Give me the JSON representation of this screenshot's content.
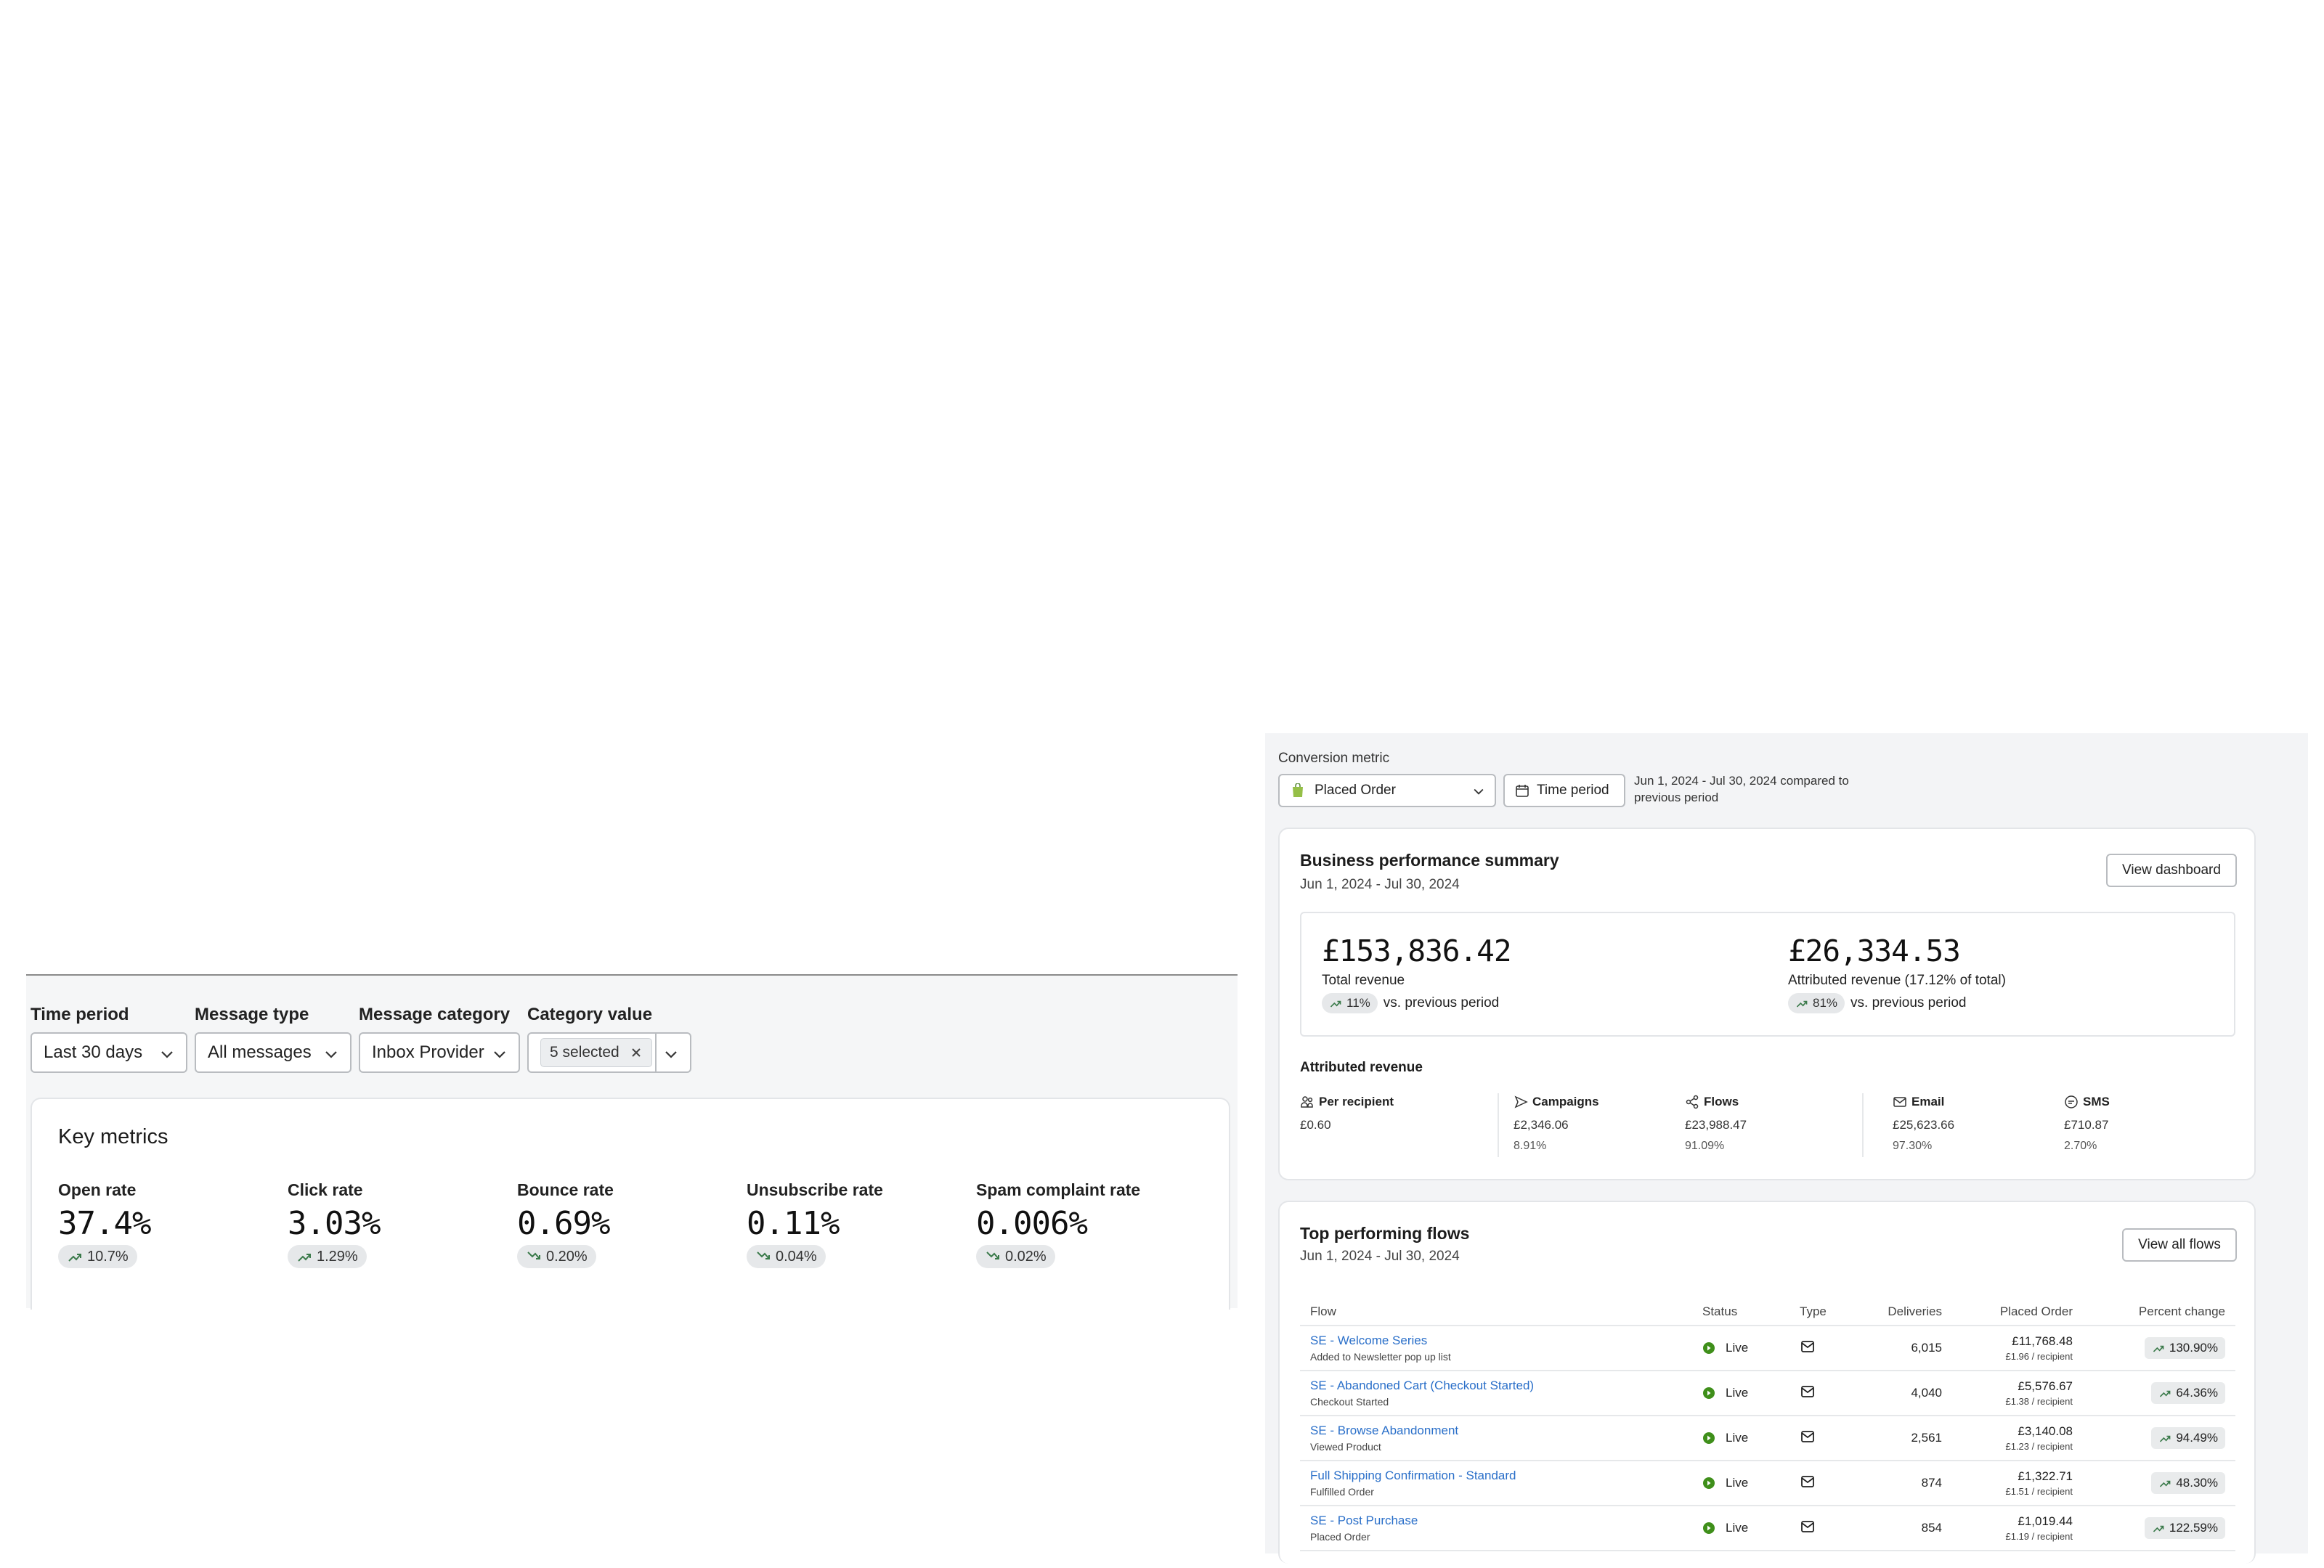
{
  "filters": {
    "time_period": {
      "label": "Time period",
      "value": "Last 30 days"
    },
    "message_type": {
      "label": "Message type",
      "value": "All messages"
    },
    "message_category": {
      "label": "Message category",
      "value": "Inbox Provider"
    },
    "category_value": {
      "label": "Category value",
      "chip": "5 selected"
    }
  },
  "key_metrics": {
    "title": "Key metrics",
    "items": [
      {
        "label": "Open rate",
        "value": "37.4%",
        "change": "10.7%",
        "direction": "up"
      },
      {
        "label": "Click rate",
        "value": "3.03%",
        "change": "1.29%",
        "direction": "up"
      },
      {
        "label": "Bounce rate",
        "value": "0.69%",
        "change": "0.20%",
        "direction": "down"
      },
      {
        "label": "Unsubscribe rate",
        "value": "0.11%",
        "change": "0.04%",
        "direction": "down"
      },
      {
        "label": "Spam complaint rate",
        "value": "0.006%",
        "change": "0.02%",
        "direction": "down"
      }
    ]
  },
  "conversion": {
    "label": "Conversion metric",
    "selected": "Placed Order",
    "time_period_button": "Time period",
    "period_note": "Jun 1, 2024 - Jul 30, 2024 compared to previous period"
  },
  "summary": {
    "title": "Business performance summary",
    "date_range": "Jun 1, 2024 - Jul 30, 2024",
    "view_button": "View dashboard",
    "total": {
      "value": "£153,836.42",
      "label": "Total revenue",
      "change": "11%",
      "vs": "vs. previous period"
    },
    "attributed": {
      "value": "£26,334.53",
      "label": "Attributed revenue (17.12% of total)",
      "change": "81%",
      "vs": "vs. previous period"
    },
    "attributed_title": "Attributed revenue",
    "columns": [
      {
        "label": "Per recipient",
        "icon": "people-icon",
        "value": "£0.60",
        "sub": ""
      },
      {
        "label": "Campaigns",
        "icon": "send-icon",
        "value": "£2,346.06",
        "sub": "8.91%"
      },
      {
        "label": "Flows",
        "icon": "flow-icon",
        "value": "£23,988.47",
        "sub": "91.09%"
      },
      {
        "label": "Email",
        "icon": "mail-icon",
        "value": "£25,623.66",
        "sub": "97.30%"
      },
      {
        "label": "SMS",
        "icon": "sms-icon",
        "value": "£710.87",
        "sub": "2.70%"
      }
    ]
  },
  "flows": {
    "title": "Top performing flows",
    "date_range": "Jun 1, 2024 - Jul 30, 2024",
    "view_button": "View all flows",
    "headers": {
      "flow": "Flow",
      "status": "Status",
      "type": "Type",
      "deliveries": "Deliveries",
      "placed_order": "Placed Order",
      "percent_change": "Percent change"
    },
    "rows": [
      {
        "name": "SE - Welcome Series",
        "trigger": "Added to Newsletter pop up list",
        "status": "Live",
        "deliveries": "6,015",
        "revenue": "£11,768.48",
        "per_recipient": "£1.96 / recipient",
        "change": "130.90%"
      },
      {
        "name": "SE - Abandoned Cart (Checkout Started)",
        "trigger": "Checkout Started",
        "status": "Live",
        "deliveries": "4,040",
        "revenue": "£5,576.67",
        "per_recipient": "£1.38 / recipient",
        "change": "64.36%"
      },
      {
        "name": "SE - Browse Abandonment",
        "trigger": "Viewed Product",
        "status": "Live",
        "deliveries": "2,561",
        "revenue": "£3,140.08",
        "per_recipient": "£1.23 / recipient",
        "change": "94.49%"
      },
      {
        "name": "Full Shipping Confirmation - Standard",
        "trigger": "Fulfilled Order",
        "status": "Live",
        "deliveries": "874",
        "revenue": "£1,322.71",
        "per_recipient": "£1.51 / recipient",
        "change": "48.30%"
      },
      {
        "name": "SE - Post Purchase",
        "trigger": "Placed Order",
        "status": "Live",
        "deliveries": "854",
        "revenue": "£1,019.44",
        "per_recipient": "£1.19 / recipient",
        "change": "122.59%"
      }
    ]
  },
  "colors": {
    "link": "#2a6fc9",
    "live": "#3f8f1a",
    "trend_up": "#3a7a4a",
    "panel_bg": "#f3f4f6"
  }
}
